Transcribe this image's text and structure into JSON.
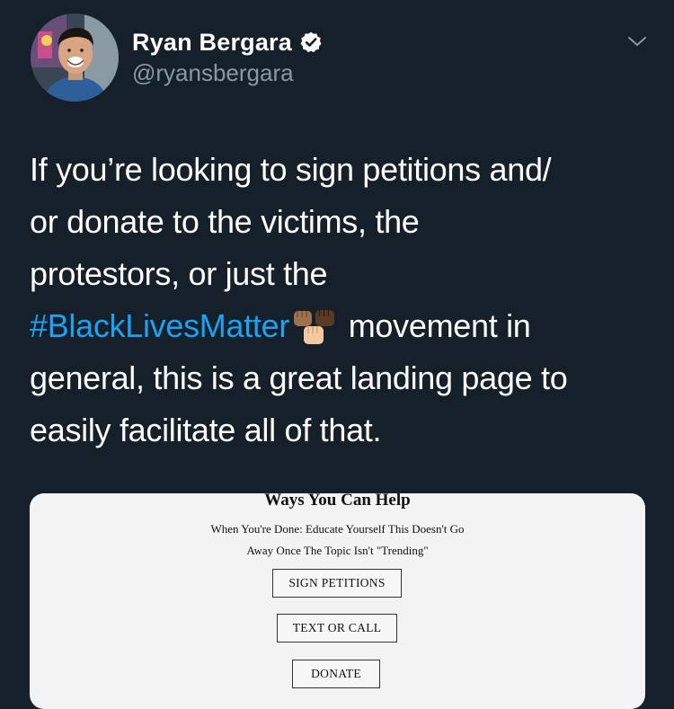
{
  "tweet": {
    "author": {
      "display_name": "Ryan Bergara",
      "handle": "@ryansbergara",
      "verified": true
    },
    "text_lines": [
      "If you’re looking to sign petitions and/",
      "or donate to the victims, the",
      "protestors, or just the"
    ],
    "hashtag": "#BlackLivesMatter",
    "emoji": "fist-emoji",
    "after_hashtag": " movement in",
    "text_lines_after": [
      "general, this is a great landing page to",
      "easily facilitate all of that."
    ],
    "colors": {
      "background": "#15202b",
      "text": "#ffffff",
      "secondary_text": "#8899a6",
      "link": "#1da1f2"
    }
  },
  "card": {
    "heading": "Ways You Can Help",
    "subtext_line1": "When You're Done: Educate Yourself This Doesn't Go",
    "subtext_line2": "Away Once The Topic Isn't \"Trending\"",
    "buttons": [
      {
        "label": "SIGN PETITIONS"
      },
      {
        "label": "TEXT OR CALL"
      },
      {
        "label": "DONATE"
      }
    ]
  }
}
